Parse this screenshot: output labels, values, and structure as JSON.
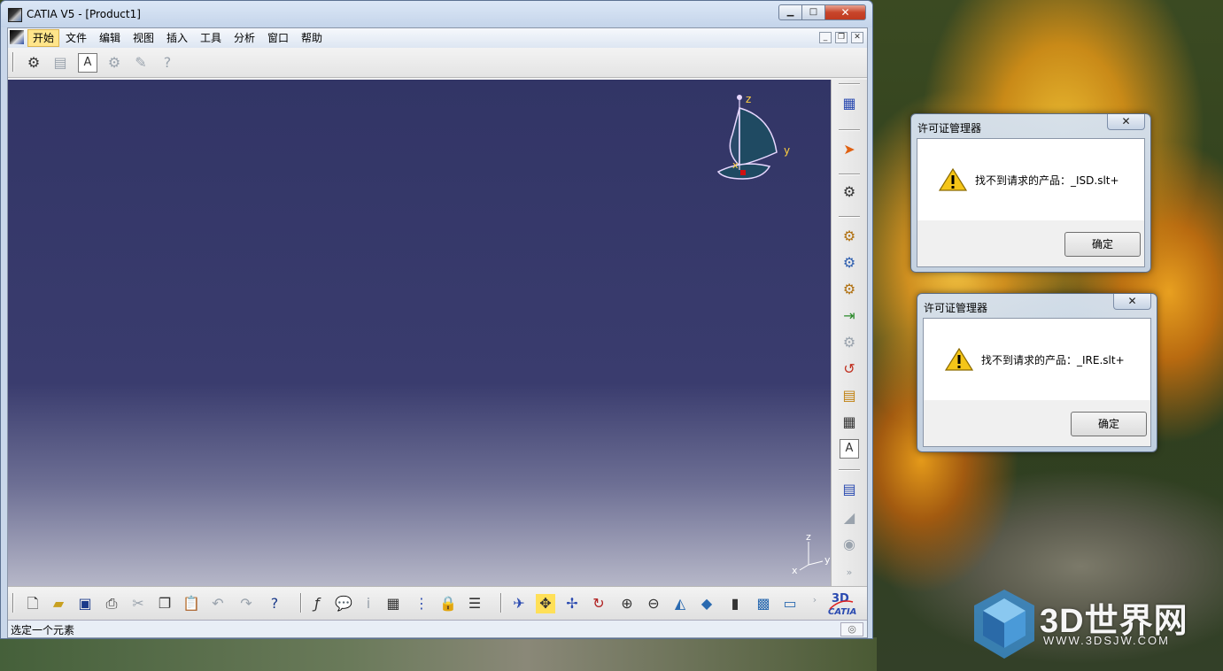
{
  "window": {
    "title": "CATIA V5 - [Product1]",
    "controls": {
      "minimize": "▁",
      "maximize": "□",
      "close": "✕"
    }
  },
  "menu": {
    "items": [
      "开始",
      "文件",
      "编辑",
      "视图",
      "插入",
      "工具",
      "分析",
      "窗口",
      "帮助"
    ],
    "active_index": 0,
    "mdi_controls": {
      "minimize": "_",
      "restore": "❐",
      "close": "✕"
    }
  },
  "viewport": {
    "background_top": "#323566",
    "background_bottom": "#b6b7c8",
    "compass_labels": {
      "z": "z",
      "y": "y",
      "x": "x"
    },
    "mini_axis_labels": {
      "z": "z",
      "y": "y",
      "x": "x"
    }
  },
  "toolbars": {
    "top_icons": [
      "product-structure-icon",
      "properties-icon",
      "text-icon",
      "gear-group-icon",
      "repair-icon",
      "help-circle-icon"
    ],
    "right_icons": [
      "product-icon",
      "select-arrow-icon",
      "select-cursor-icon",
      "gear-insert-icon",
      "gear-new-icon",
      "gear-existing-icon",
      "insert-arrow-icon",
      "sub-graph-icon",
      "replace-icon",
      "reorder-icon",
      "numbering-icon",
      "annotation-icon",
      "scene-icon",
      "measure-icon",
      "view-icon"
    ],
    "bottom_icons": [
      "new-icon",
      "open-icon",
      "save-icon",
      "print-icon",
      "cut-icon",
      "copy-icon",
      "paste-icon",
      "undo-icon",
      "redo-icon",
      "whats-this-icon",
      "formula-icon",
      "comment-icon",
      "info-icon",
      "table-icon",
      "tree-icon",
      "lock-icon",
      "catalog-icon",
      "fly-icon",
      "fit-all-icon",
      "pan-icon",
      "rotate-icon",
      "zoom-in-icon",
      "zoom-out-icon",
      "normal-view-icon",
      "iso-view-icon",
      "hide-show-icon",
      "shading-icon",
      "swap-icon"
    ]
  },
  "status": {
    "text": "选定一个元素"
  },
  "dialogs": [
    {
      "title": "许可证管理器",
      "message": "找不到请求的产品：_ISD.slt+",
      "ok_label": "确定",
      "close_label": "✕"
    },
    {
      "title": "许可证管理器",
      "message": "找不到请求的产品：_IRE.slt+",
      "ok_label": "确定",
      "close_label": "✕"
    }
  ],
  "watermark": {
    "brand": "3D世界网",
    "url": "WWW.3DSJW.COM"
  }
}
